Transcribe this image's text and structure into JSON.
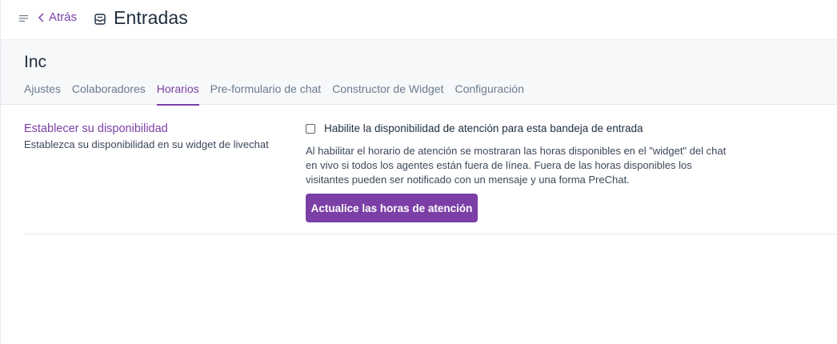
{
  "header": {
    "back_label": "Atrás",
    "title": "Entradas",
    "icons": {
      "menu": "menu-icon",
      "back": "chevron-left-icon",
      "title": "inbox-icon"
    }
  },
  "inbox": {
    "name": "Inc"
  },
  "tabs": [
    {
      "label": "Ajustes",
      "active": false
    },
    {
      "label": "Colaboradores",
      "active": false
    },
    {
      "label": "Horarios",
      "active": true
    },
    {
      "label": "Pre-formulario de chat",
      "active": false
    },
    {
      "label": "Constructor de Widget",
      "active": false
    },
    {
      "label": "Configuración",
      "active": false
    }
  ],
  "availability": {
    "title": "Establecer su disponibilidad",
    "description": "Establezca su disponibilidad en su widget de livechat",
    "checkbox_label": "Habilite la disponibilidad de atención para esta bandeja de entrada",
    "checkbox_checked": false,
    "help_text": "Al habilitar el horario de atención se mostraran las horas disponibles en el \"widget\" del chat en vivo si todos los agentes están fuera de línea. Fuera de las horas disponibles los visitantes pueden ser notificado con un mensaje y una forma PreChat.",
    "button_label": "Actualice las horas de atención"
  },
  "colors": {
    "accent": "#7b3fa6",
    "text": "#1f2d3d",
    "muted": "#6b7b8c"
  }
}
